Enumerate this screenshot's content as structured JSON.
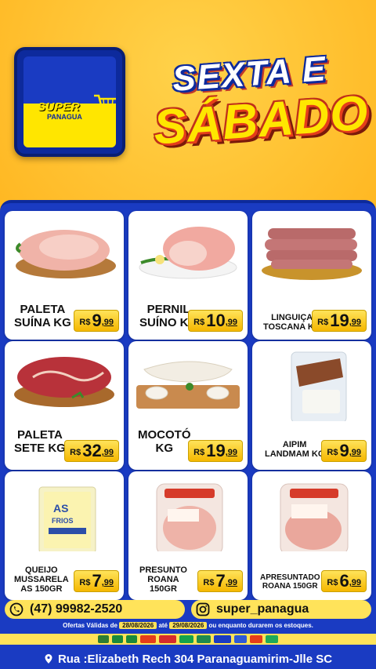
{
  "logo": {
    "brand": "SUPER",
    "sub": "PANAGUA"
  },
  "headline": {
    "line1": "SEXTA E",
    "line2": "SÁBADO"
  },
  "currency": "R$",
  "products": [
    {
      "name": [
        "PALETA",
        "SUÍNA KG"
      ],
      "price_int": "9",
      "price_cents": ",99",
      "icon": "pork-shoulder-image"
    },
    {
      "name": [
        "PERNIL",
        "SUÍNO KG"
      ],
      "price_int": "10",
      "price_cents": ",99",
      "icon": "pork-leg-image"
    },
    {
      "name": [
        "LINGUIÇA",
        "TOSCANA KG"
      ],
      "price_int": "19",
      "price_cents": ",99",
      "icon": "sausage-image"
    },
    {
      "name": [
        "PALETA",
        "SETE KG"
      ],
      "price_int": "32",
      "price_cents": ",99",
      "icon": "beef-image"
    },
    {
      "name": [
        "MOCOTÓ",
        "KG"
      ],
      "price_int": "19",
      "price_cents": ",99",
      "icon": "mocoto-image"
    },
    {
      "name": [
        "AIPIM",
        "LANDMAM KG"
      ],
      "price_int": "9",
      "price_cents": ",99",
      "icon": "cassava-image"
    },
    {
      "name": [
        "QUEIJO",
        "MUSSARELA",
        "AS 150GR"
      ],
      "price_int": "7",
      "price_cents": ",99",
      "icon": "cheese-image"
    },
    {
      "name": [
        "PRESUNTO",
        "ROANA",
        "150GR"
      ],
      "price_int": "7",
      "price_cents": ",99",
      "icon": "ham-image"
    },
    {
      "name": [
        "APRESUNTADO",
        "ROANA 150GR"
      ],
      "price_int": "6",
      "price_cents": ",99",
      "icon": "apresuntado-image"
    }
  ],
  "footer": {
    "phone": "(47) 99982-2520",
    "instagram": "super_panagua",
    "validity_prefix": "Ofertas Válidas de",
    "date_from": "28/08/2026",
    "date_sep": "até",
    "date_to": "29/08/2026",
    "validity_suffix": "ou enquanto durarem os estoques.",
    "address": "Rua :Elizabeth Rech 304 Paranaguamirim-Jlle SC"
  },
  "colors": {
    "brand_blue": "#1a3bc2",
    "brand_yellow": "#ffe35a",
    "headline_yellow": "#ffe600",
    "headline_red": "#e53d1a"
  }
}
